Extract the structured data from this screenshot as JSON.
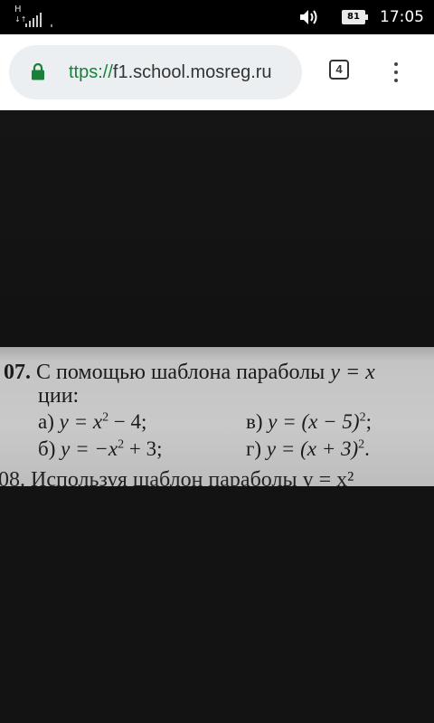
{
  "status_bar": {
    "network_type": "H",
    "network_sub": "↓↑",
    "signal_icon": "signal-bars-icon",
    "volume_icon": "volume-icon",
    "battery_level": "81",
    "time": "17:05"
  },
  "browser": {
    "url_scheme": "ttps://",
    "url_host": "f1.school.mosreg.ru",
    "tab_count": "4",
    "lock_icon": "lock-icon",
    "menu_icon": "more-vert-icon",
    "accent_color": "#188038"
  },
  "photo": {
    "problem_number": "07.",
    "problem_text_line1": "С помощью шаблона параболы",
    "problem_text_math_start": "y = x",
    "problem_text_line2": "ции:",
    "items": [
      {
        "label": "а)",
        "expr": "y = x",
        "sup": "2",
        "rest": " − 4;"
      },
      {
        "label": "б)",
        "expr": "y = −x",
        "sup": "2",
        "rest": " + 3;"
      },
      {
        "label": "в)",
        "expr": "y = (x − 5)",
        "sup": "2",
        "rest": ";"
      },
      {
        "label": "г)",
        "expr": "y = (x + 3)",
        "sup": "2",
        "rest": "."
      }
    ],
    "next_problem_cut": "08. Используя шаблон параболы y = x²"
  }
}
